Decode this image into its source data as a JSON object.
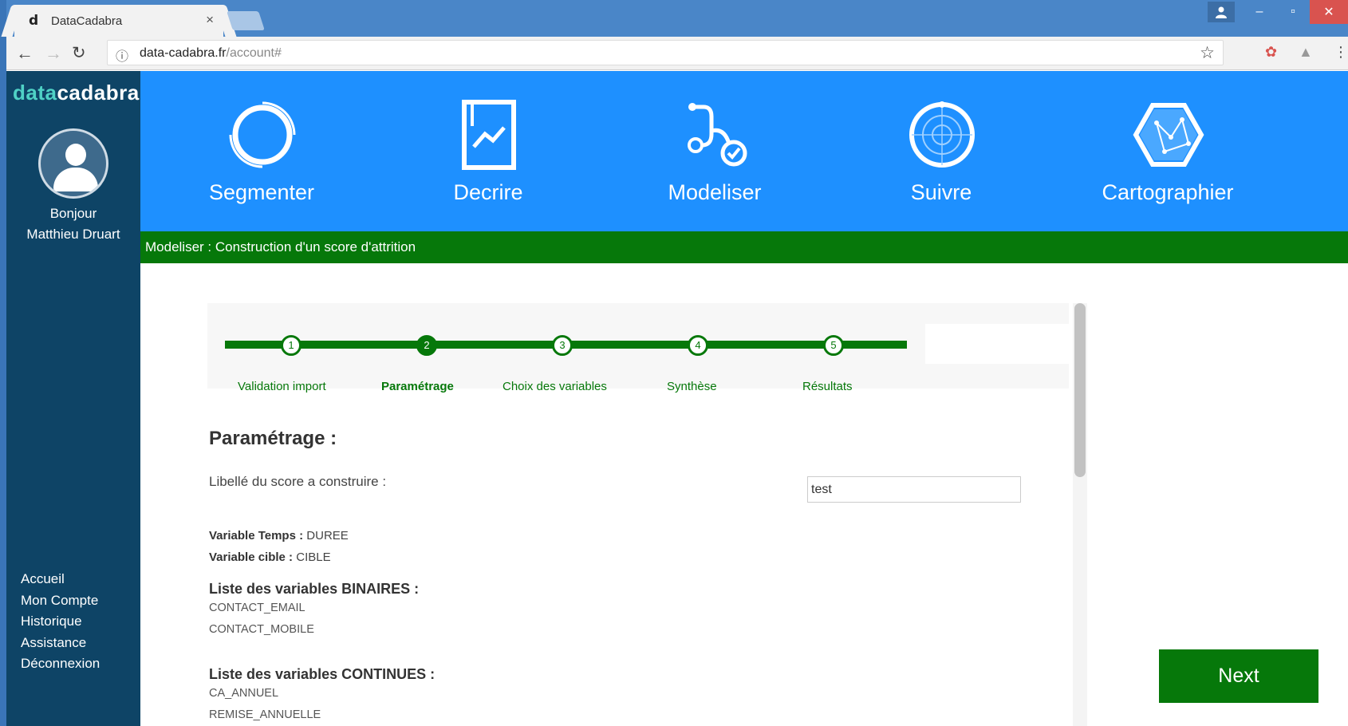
{
  "browser": {
    "tab_title": "DataCadabra",
    "tab_close": "×",
    "favicon": "d",
    "url_host": "data-cadabra.fr",
    "url_path": "/account#",
    "icons": [
      "back-arrow-icon",
      "forward-arrow-icon",
      "reload-icon",
      "info-icon",
      "star-icon",
      "extension-icon",
      "profile-icon",
      "menu-icon"
    ],
    "window_buttons": [
      "–",
      "▫",
      "✕"
    ]
  },
  "sidebar": {
    "logo_part1": "data",
    "logo_part2": "cadabra",
    "greeting": "Bonjour",
    "user_name": "Matthieu Druart",
    "links": [
      "Accueil",
      "Mon Compte",
      "Historique",
      "Assistance",
      "Déconnexion"
    ]
  },
  "modules": [
    {
      "label": "Segmenter",
      "icon": "segment-ring-icon"
    },
    {
      "label": "Decrire",
      "icon": "trend-document-icon"
    },
    {
      "label": "Modeliser",
      "icon": "stethoscope-icon"
    },
    {
      "label": "Suivre",
      "icon": "radar-icon"
    },
    {
      "label": "Cartographier",
      "icon": "hexagon-map-icon"
    }
  ],
  "breadcrumb": "Modeliser : Construction d'un score d'attrition",
  "stepper": {
    "active_step": 2,
    "steps": [
      {
        "number": "1",
        "label": "Validation import"
      },
      {
        "number": "2",
        "label": "Paramétrage"
      },
      {
        "number": "3",
        "label": "Choix des variables"
      },
      {
        "number": "4",
        "label": "Synthèse"
      },
      {
        "number": "5",
        "label": "Résultats"
      }
    ]
  },
  "form": {
    "heading": "Paramétrage :",
    "score_label": "Libellé du score a construire :",
    "score_value": "test",
    "time_var_label": "Variable Temps :",
    "time_var_value": "DUREE",
    "target_var_label": "Variable cible :",
    "target_var_value": "CIBLE",
    "binary_heading": "Liste des variables BINAIRES :",
    "binary_vars": [
      "CONTACT_EMAIL",
      "CONTACT_MOBILE"
    ],
    "continuous_heading": "Liste des variables CONTINUES :",
    "continuous_vars": [
      "CA_ANNUEL",
      "REMISE_ANNUELLE"
    ]
  },
  "next_label": "Next",
  "colors": {
    "sidebar": "#0e4466",
    "module_bar": "#1e90ff",
    "accent_green": "#06780a",
    "logo_teal": "#4fd1c5"
  }
}
